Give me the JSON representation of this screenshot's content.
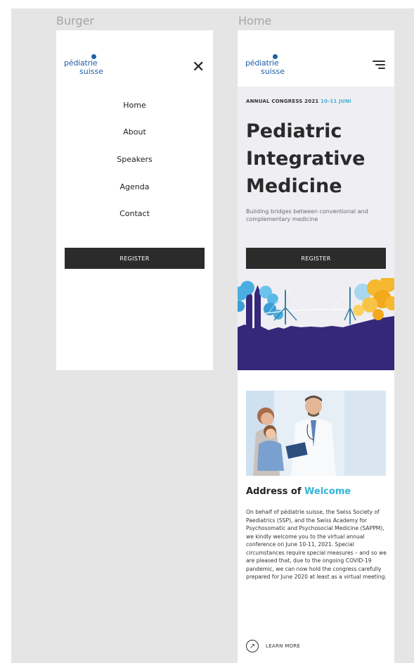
{
  "frames": {
    "burger_label": "Burger",
    "home_label": "Home"
  },
  "logo": {
    "line1": "pédiatrie",
    "line2": "suisse"
  },
  "burger": {
    "close_glyph": "✕",
    "menu": [
      "Home",
      "About",
      "Speakers",
      "Agenda",
      "Contact"
    ],
    "register_label": "REGISTER"
  },
  "home": {
    "kicker": "ANNUAL CONGRESS 2021",
    "kicker_dates": "10-11 JUNI",
    "title_lines": [
      "Pediatric",
      "Integrative",
      "Medicine"
    ],
    "subtitle": "Building bridges between conventional and complementary medicine",
    "register_label": "REGISTER",
    "welcome_title": "Address of",
    "welcome_title_accent": "Welcome",
    "welcome_body": "On behalf of pédiatrie suisse, the Swiss Society of Paediatrics (SSP), and the Swiss Academy for Psychosomatic and Psychosocial Medicine (SAPPM), we kindly welcome you to the virtual annual conference on June 10-11, 2021. Special circumstances require special measures – and so we are pleased that, due to the ongoing COVID-19 pandemic, we can now hold the congress carefully prepared for June 2020 at least as a virtual meeting.",
    "learn_more_label": "LEARN MORE",
    "learn_more_icon": "arrow-up-right-icon"
  },
  "colors": {
    "accent_blue": "#3ab3d6",
    "logo_blue": "#1f5fa8",
    "dark_button": "#2b2b2b",
    "skyline_purple": "#35287a",
    "hero_bg": "#eeeef3",
    "tree_yellow": "#f5b82e"
  }
}
